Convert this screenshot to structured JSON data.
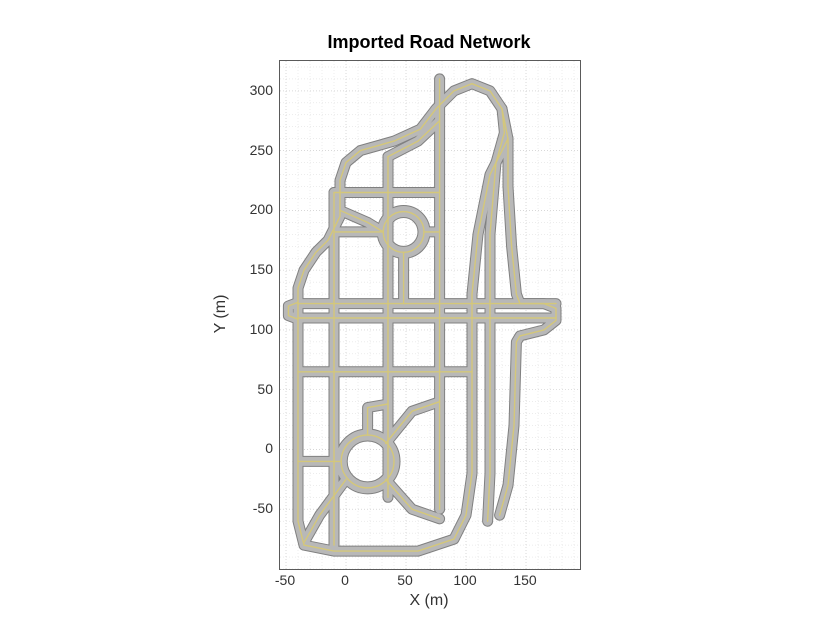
{
  "chart_data": {
    "type": "map",
    "title": "Imported Road Network",
    "xlabel": "X (m)",
    "ylabel": "Y (m)",
    "xlim": [
      -55,
      195
    ],
    "ylim": [
      -100,
      325
    ],
    "xticks": [
      -50,
      0,
      50,
      100,
      150
    ],
    "yticks": [
      -50,
      0,
      50,
      100,
      150,
      200,
      250,
      300
    ],
    "grid": true,
    "road_color": "#b8b8b8",
    "lane_color": "#d4c77a",
    "roundabouts": [
      {
        "cx": 18,
        "cy": -10,
        "r": 22
      },
      {
        "cx": 48,
        "cy": 182,
        "r": 17
      }
    ],
    "roads": [
      {
        "name": "outer-loop",
        "type": "polyline",
        "pts": [
          [
            -35,
            -80
          ],
          [
            -40,
            -60
          ],
          [
            -40,
            135
          ],
          [
            -35,
            150
          ],
          [
            -25,
            165
          ],
          [
            -15,
            175
          ],
          [
            -5,
            195
          ],
          [
            -5,
            225
          ],
          [
            0,
            240
          ],
          [
            12,
            250
          ],
          [
            40,
            258
          ],
          [
            62,
            268
          ],
          [
            75,
            285
          ],
          [
            90,
            300
          ],
          [
            105,
            306
          ],
          [
            120,
            300
          ],
          [
            130,
            285
          ],
          [
            135,
            260
          ],
          [
            120,
            230
          ],
          [
            110,
            180
          ],
          [
            105,
            130
          ],
          [
            105,
            80
          ],
          [
            105,
            -20
          ],
          [
            100,
            -55
          ],
          [
            90,
            -75
          ],
          [
            60,
            -85
          ],
          [
            -10,
            -85
          ],
          [
            -35,
            -80
          ]
        ]
      },
      {
        "name": "outer-loop-2",
        "type": "polyline",
        "pts": [
          [
            118,
            -60
          ],
          [
            120,
            -20
          ],
          [
            120,
            80
          ],
          [
            120,
            180
          ],
          [
            125,
            240
          ],
          [
            132,
            265
          ],
          [
            130,
            285
          ]
        ]
      },
      {
        "name": "outer-loop-3",
        "type": "polyline",
        "pts": [
          [
            128,
            -55
          ],
          [
            135,
            -30
          ],
          [
            140,
            20
          ],
          [
            142,
            90
          ],
          [
            145,
            95
          ],
          [
            165,
            100
          ],
          [
            175,
            108
          ],
          [
            175,
            118
          ],
          [
            165,
            122
          ],
          [
            145,
            122
          ],
          [
            142,
            130
          ],
          [
            138,
            170
          ],
          [
            135,
            220
          ],
          [
            135,
            260
          ]
        ]
      },
      {
        "name": "v-street-a",
        "type": "polyline",
        "pts": [
          [
            -10,
            -80
          ],
          [
            -10,
            215
          ]
        ]
      },
      {
        "name": "v-street-b",
        "type": "polyline",
        "pts": [
          [
            35,
            -40
          ],
          [
            35,
            245
          ]
        ]
      },
      {
        "name": "v-street-c",
        "type": "polyline",
        "pts": [
          [
            78,
            -50
          ],
          [
            78,
            310
          ]
        ]
      },
      {
        "name": "h-street-1",
        "type": "polyline",
        "pts": [
          [
            -40,
            65
          ],
          [
            105,
            65
          ]
        ]
      },
      {
        "name": "h-street-2",
        "type": "polyline",
        "pts": [
          [
            -40,
            110
          ],
          [
            175,
            110
          ]
        ]
      },
      {
        "name": "h-street-2b",
        "type": "polyline",
        "pts": [
          [
            -40,
            122
          ],
          [
            175,
            122
          ]
        ]
      },
      {
        "name": "h-street-3",
        "type": "polyline",
        "pts": [
          [
            -10,
            215
          ],
          [
            78,
            215
          ]
        ]
      },
      {
        "name": "diag-top",
        "type": "polyline",
        "pts": [
          [
            35,
            245
          ],
          [
            60,
            258
          ],
          [
            78,
            275
          ]
        ]
      },
      {
        "name": "rb1-arm-ne",
        "type": "polyline",
        "pts": [
          [
            33,
            5
          ],
          [
            55,
            32
          ],
          [
            78,
            40
          ]
        ]
      },
      {
        "name": "rb1-arm-sw",
        "type": "polyline",
        "pts": [
          [
            0,
            -25
          ],
          [
            -22,
            -55
          ],
          [
            -35,
            -78
          ]
        ]
      },
      {
        "name": "rb1-arm-se",
        "type": "polyline",
        "pts": [
          [
            33,
            -25
          ],
          [
            55,
            -50
          ],
          [
            78,
            -58
          ]
        ]
      },
      {
        "name": "rb1-arm-w",
        "type": "polyline",
        "pts": [
          [
            -5,
            -10
          ],
          [
            -40,
            -10
          ]
        ]
      },
      {
        "name": "rb1-arm-n",
        "type": "polyline",
        "pts": [
          [
            18,
            12
          ],
          [
            18,
            35
          ],
          [
            35,
            38
          ]
        ]
      },
      {
        "name": "rb2-arm-e",
        "type": "polyline",
        "pts": [
          [
            65,
            182
          ],
          [
            78,
            182
          ]
        ]
      },
      {
        "name": "rb2-arm-w",
        "type": "polyline",
        "pts": [
          [
            31,
            182
          ],
          [
            -10,
            182
          ]
        ]
      },
      {
        "name": "rb2-arm-s",
        "type": "polyline",
        "pts": [
          [
            48,
            165
          ],
          [
            48,
            122
          ]
        ]
      },
      {
        "name": "w-bulge",
        "type": "polyline",
        "pts": [
          [
            -40,
            109
          ],
          [
            -48,
            112
          ],
          [
            -48,
            120
          ],
          [
            -40,
            123
          ]
        ]
      },
      {
        "name": "curve-upper",
        "type": "polyline",
        "pts": [
          [
            -5,
            200
          ],
          [
            18,
            190
          ],
          [
            31,
            182
          ]
        ]
      }
    ]
  }
}
